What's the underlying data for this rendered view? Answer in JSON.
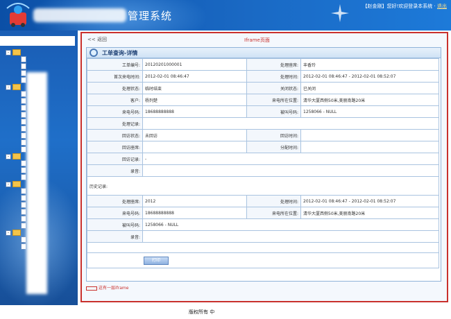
{
  "header": {
    "title": "管理系统",
    "user": "【赵金刚】您好!欢迎登录本系统 ·",
    "logout": "退出"
  },
  "frame": {
    "back_label": "<< 返回",
    "iframe_note": "Iframe页面",
    "card_title": "工单查询-详情",
    "print_label": "打印",
    "bottom_note": "这有一层iframe"
  },
  "detail_rows": [
    [
      "工单编号:",
      "20120201000001",
      "处理座席:",
      "丰香玲"
    ],
    [
      "首次来电时间:",
      "2012-02-01 08:46:47",
      "处理时间:",
      "2012-02-01 08:46:47  -  2012-02-01 08:52:07"
    ],
    [
      "处理状态:",
      "临时结束",
      "关闭状态:",
      "已关闭"
    ],
    [
      "客户:",
      "杨列楚",
      "来电所在位置:",
      "清华大厦西侧50米,美丽南路20米"
    ],
    [
      "来电号码:",
      "18688888888",
      "被叫号码:",
      "1258066 - NULL"
    ]
  ],
  "single_rows": [
    [
      "处理记录:",
      ""
    ]
  ],
  "visit_rows": [
    [
      "回访状态:",
      "未回访",
      "回访时间:",
      ""
    ],
    [
      "回访座席:",
      "",
      "分配时间:",
      ""
    ]
  ],
  "visit_single": [
    [
      "回访记录:",
      "-"
    ],
    [
      "录音:",
      ""
    ]
  ],
  "history": {
    "label": "历史记录:",
    "rows": [
      [
        "处理座席:",
        "2012",
        "处理时间:",
        "2012-02-01 08:46:47  -  2012-02-01 08:52:07"
      ],
      [
        "来电号码:",
        "18688888888",
        "来电所在位置:",
        "清华大厦西侧50米,美丽南路20米"
      ]
    ],
    "singles": [
      [
        "被叫号码:",
        "1258066 - NULL"
      ],
      [
        "录音:",
        ""
      ]
    ]
  },
  "footer": {
    "text": "版权所有 中"
  }
}
